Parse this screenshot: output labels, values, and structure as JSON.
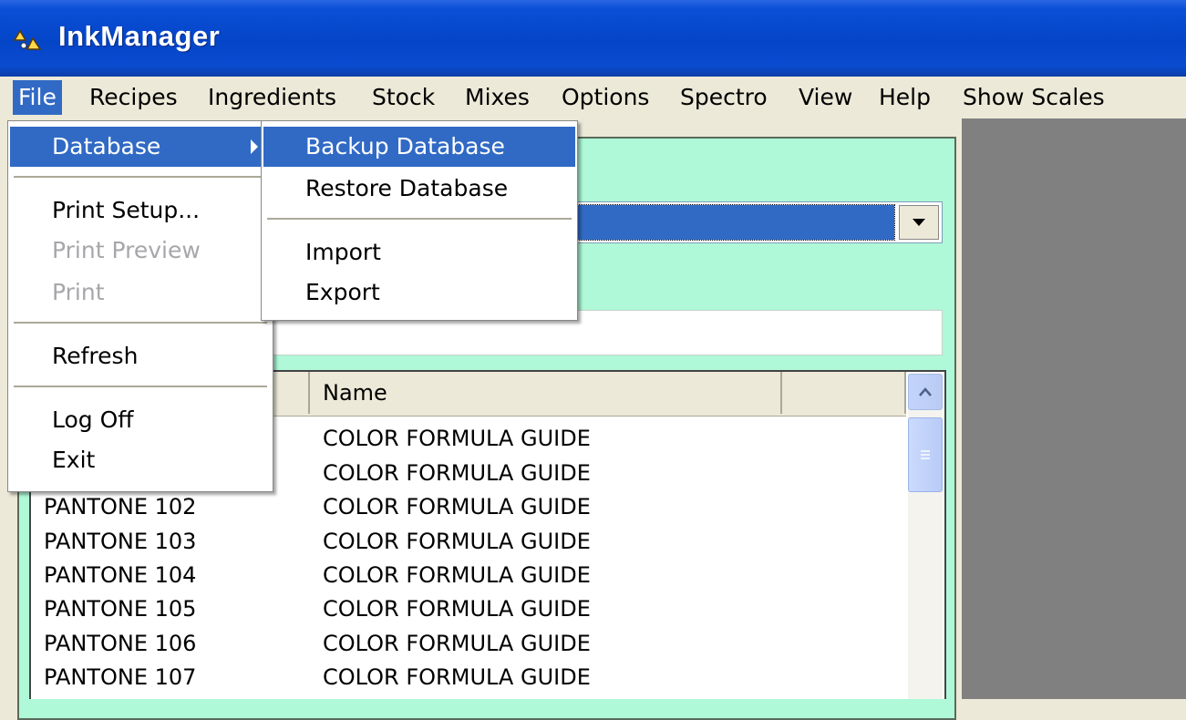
{
  "window": {
    "title": "InkManager"
  },
  "menubar": {
    "items": [
      "File",
      "Recipes",
      "Ingredients",
      "Stock",
      "Mixes",
      "Options",
      "Spectro",
      "View",
      "Help",
      "Show Scales"
    ]
  },
  "file_menu": {
    "database": "Database",
    "print_setup": "Print Setup...",
    "print_preview": "Print Preview",
    "print": "Print",
    "refresh": "Refresh",
    "log_off": "Log Off",
    "exit": "Exit"
  },
  "database_submenu": {
    "backup": "Backup Database",
    "restore": "Restore Database",
    "import": "Import",
    "export": "Export"
  },
  "list": {
    "columns": [
      "",
      "Name"
    ],
    "rows": [
      {
        "code": "",
        "name": "COLOR FORMULA GUIDE"
      },
      {
        "code": "",
        "name": "COLOR FORMULA GUIDE"
      },
      {
        "code": "PANTONE 102",
        "name": "COLOR FORMULA GUIDE"
      },
      {
        "code": "PANTONE 103",
        "name": "COLOR FORMULA GUIDE"
      },
      {
        "code": "PANTONE 104",
        "name": "COLOR FORMULA GUIDE"
      },
      {
        "code": "PANTONE 105",
        "name": "COLOR FORMULA GUIDE"
      },
      {
        "code": "PANTONE 106",
        "name": "COLOR FORMULA GUIDE"
      },
      {
        "code": "PANTONE 107",
        "name": "COLOR FORMULA GUIDE"
      }
    ]
  },
  "colors": {
    "titlebar": "#0445c8",
    "highlight": "#316ac5",
    "panel": "#aff8d8",
    "workspace": "#808080"
  }
}
